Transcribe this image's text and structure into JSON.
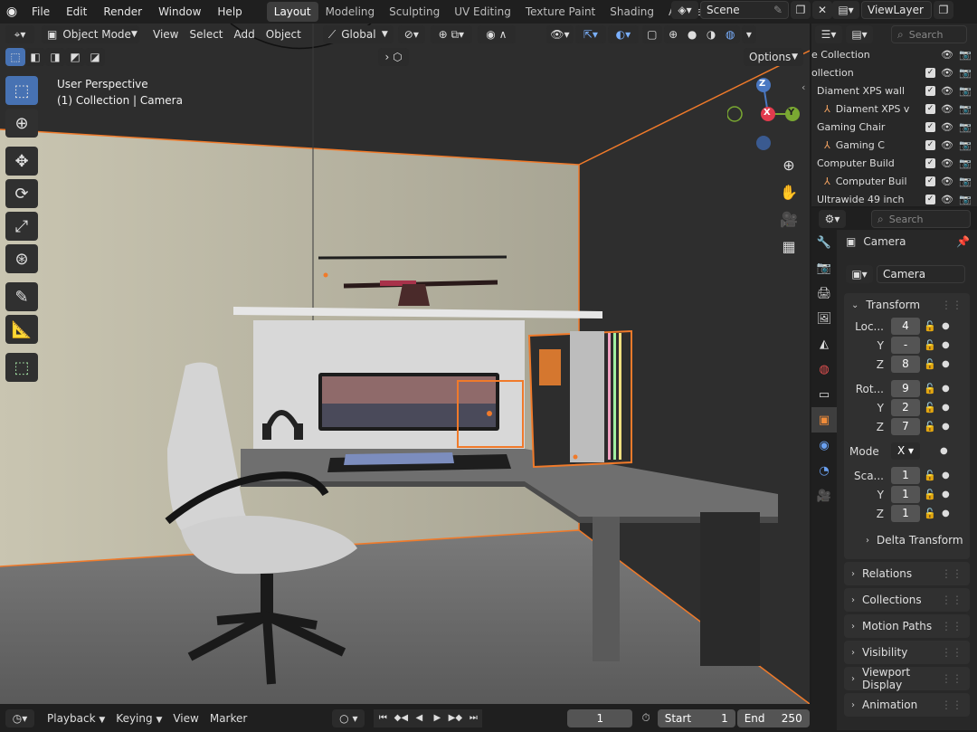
{
  "topbar": {
    "menus": [
      "File",
      "Edit",
      "Render",
      "Window",
      "Help"
    ],
    "workspaces": [
      "Layout",
      "Modeling",
      "Sculpting",
      "UV Editing",
      "Texture Paint",
      "Shading",
      "Anima"
    ],
    "active_workspace": "Layout",
    "scene": "Scene",
    "view_layer": "ViewLayer"
  },
  "viewport": {
    "mode": "Object Mode",
    "menus": [
      "View",
      "Select",
      "Add",
      "Object"
    ],
    "orientation": "Global",
    "options": "Options",
    "overlay_title": "User Perspective",
    "overlay_subtitle": "(1) Collection | Camera",
    "gizmo": {
      "z": "Z",
      "x": "X",
      "y": "Y"
    }
  },
  "outliner": {
    "search_placeholder": "Search",
    "rows": [
      {
        "label": "e Collection",
        "indent": 0,
        "checks": false
      },
      {
        "label": "ollection",
        "indent": 0,
        "checks": true
      },
      {
        "label": "Diament XPS wall",
        "indent": 1,
        "checks": true
      },
      {
        "label": "Diament XPS v",
        "indent": 2,
        "checks": true
      },
      {
        "label": "Gaming Chair",
        "indent": 1,
        "checks": true
      },
      {
        "label": "Gaming C",
        "indent": 2,
        "checks": true
      },
      {
        "label": "Computer Build",
        "indent": 1,
        "checks": true
      },
      {
        "label": "Computer Buil",
        "indent": 2,
        "checks": true
      },
      {
        "label": "Ultrawide 49 inch",
        "indent": 1,
        "checks": true
      }
    ]
  },
  "properties": {
    "search_placeholder": "Search",
    "object_name": "Camera",
    "data_name": "Camera",
    "transform": {
      "title": "Transform",
      "location_label": "Loc...",
      "location": [
        "4",
        "-",
        "8"
      ],
      "rotation_label": "Rot...",
      "rotation": [
        "9",
        "2",
        "7"
      ],
      "mode_label": "Mode",
      "mode_value": "X",
      "scale_label": "Sca...",
      "scale": [
        "1",
        "1",
        "1"
      ],
      "y_label": "Y",
      "z_label": "Z",
      "delta": "Delta Transform"
    },
    "panels": [
      "Relations",
      "Collections",
      "Motion Paths",
      "Visibility",
      "Viewport Display",
      "Animation"
    ]
  },
  "timeline": {
    "menus": [
      "Playback",
      "Keying",
      "View",
      "Marker"
    ],
    "current_frame": "1",
    "start_label": "Start",
    "start": "1",
    "end_label": "End",
    "end": "250"
  },
  "colors": {
    "accent": "#4772b3",
    "selection": "#f07a2a",
    "wall": "#bcb8a6",
    "floor": "#6e6e6e"
  }
}
